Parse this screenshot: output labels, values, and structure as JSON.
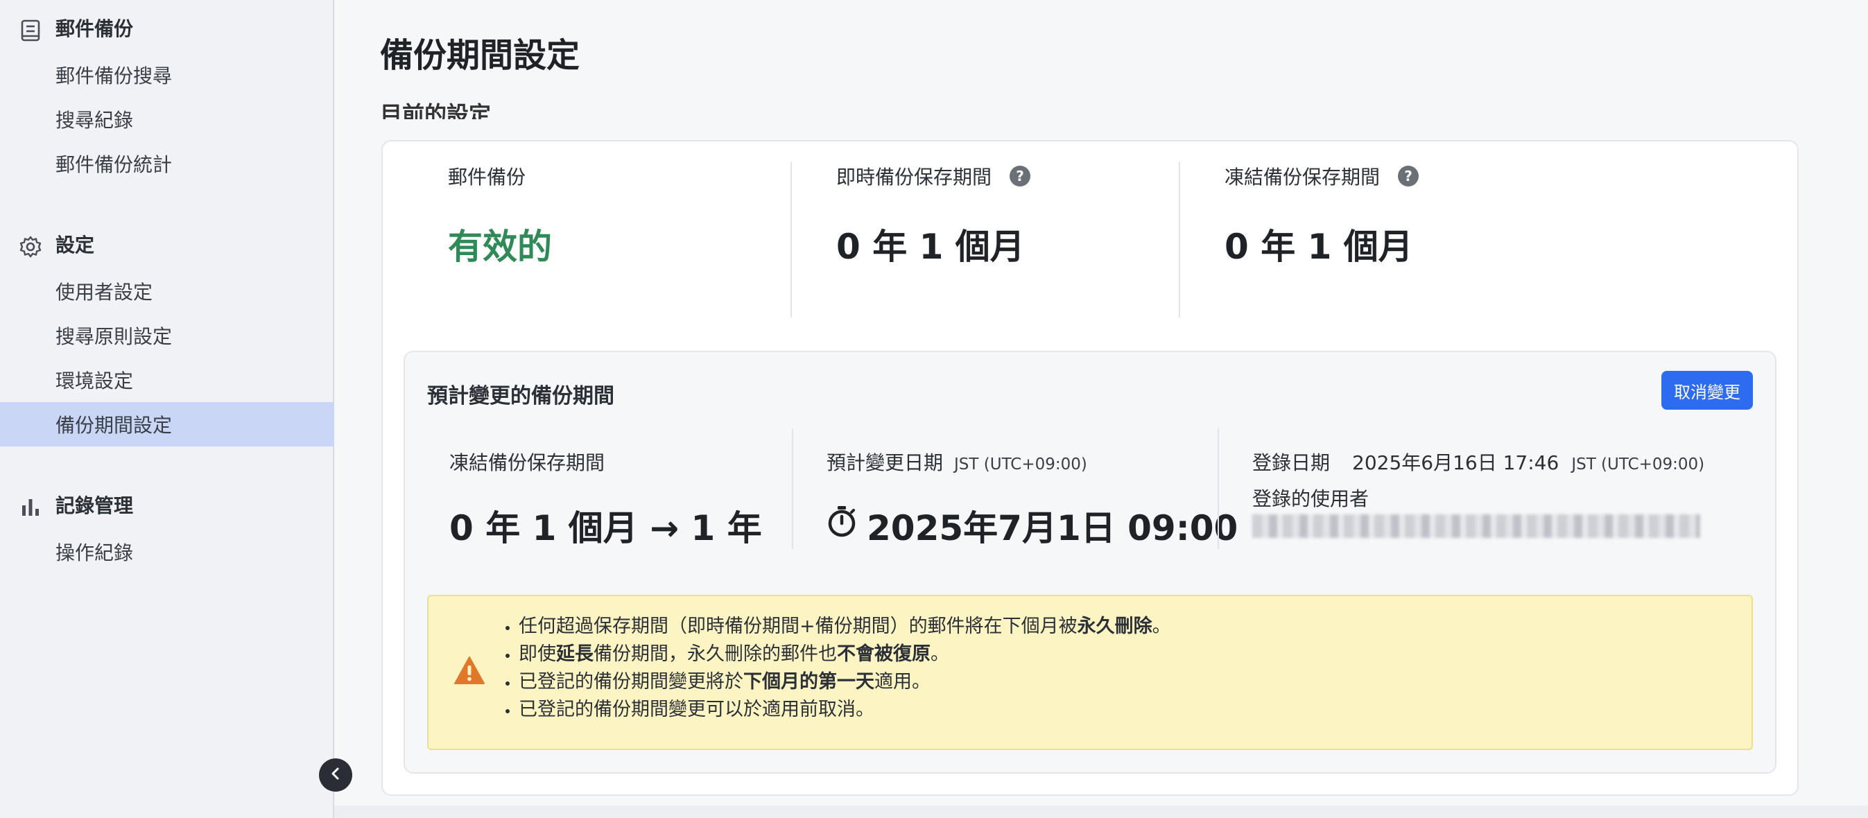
{
  "sidebar": {
    "groups": [
      {
        "label": "郵件備份",
        "icon": "mail-archive-icon",
        "items": [
          "郵件備份搜尋",
          "搜尋紀錄",
          "郵件備份統計"
        ]
      },
      {
        "label": "設定",
        "icon": "gear-icon",
        "items": [
          "使用者設定",
          "搜尋原則設定",
          "環境設定",
          "備份期間設定"
        ]
      },
      {
        "label": "記錄管理",
        "icon": "bar-chart-icon",
        "items": [
          "操作紀錄"
        ]
      }
    ],
    "active_item": "備份期間設定",
    "collapse_icon": "chevron-left-icon"
  },
  "page": {
    "title": "備份期間設定",
    "section_label": "目前的設定"
  },
  "current": {
    "mail_backup_label": "郵件備份",
    "mail_backup_value": "有效的",
    "realtime_label": "即時備份保存期間",
    "realtime_value": "0 年 1 個月",
    "frozen_label": "凍結備份保存期間",
    "frozen_value": "0 年 1 個月",
    "help_icon_text": "?"
  },
  "scheduled": {
    "title": "預計變更的備份期間",
    "cancel_button": "取消變更",
    "frozen_label": "凍結備份保存期間",
    "frozen_change": "0 年 1 個月 → 1 年",
    "date_label": "預計變更日期",
    "date_tz": "JST (UTC+09:00)",
    "date_value": "2025年7月1日 09:00",
    "registered_label": "登錄日期",
    "registered_value": "2025年6月16日 17:46",
    "registered_tz": "JST (UTC+09:00)",
    "registered_user_label": "登錄的使用者"
  },
  "warning": {
    "icon": "warning-triangle-icon",
    "color": "#e0782a",
    "line1_pre": "任何超過保存期間（即時備份期間+備份期間）的郵件將在下個月被",
    "line1_bold": "永久刪除",
    "line1_post": "。",
    "line2_pre": "即使",
    "line2_bold1": "延長",
    "line2_mid": "備份期間，永久刪除的郵件也",
    "line2_bold2": "不會被復原",
    "line2_post": "。",
    "line3_pre": "已登記的備份期間變更將於",
    "line3_bold": "下個月的第一天",
    "line3_post": "適用。",
    "line4": "已登記的備份期間變更可以於適用前取消。"
  },
  "colors": {
    "accent": "#2d6bf0",
    "active_nav_bg": "#c9d6f5",
    "valid_green": "#2e8b57",
    "warning_bg": "#fdf4c4"
  }
}
